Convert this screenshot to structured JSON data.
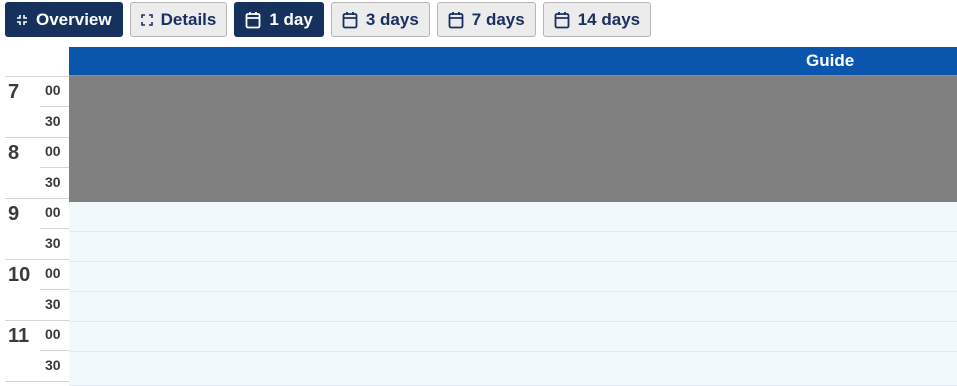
{
  "toolbar": {
    "buttons": [
      {
        "label": "Overview",
        "icon": "compress-icon",
        "active": true
      },
      {
        "label": "Details",
        "icon": "expand-icon",
        "active": false
      },
      {
        "label": "1 day",
        "icon": "calendar-icon",
        "active": true
      },
      {
        "label": "3 days",
        "icon": "calendar-icon",
        "active": false
      },
      {
        "label": "7 days",
        "icon": "calendar-icon",
        "active": false
      },
      {
        "label": "14 days",
        "icon": "calendar-icon",
        "active": false
      }
    ]
  },
  "schedule": {
    "resource": "Guide",
    "hours": [
      {
        "hour": "7",
        "minutes": [
          "00",
          "30"
        ]
      },
      {
        "hour": "8",
        "minutes": [
          "00",
          "30"
        ]
      },
      {
        "hour": "9",
        "minutes": [
          "00",
          "30"
        ]
      },
      {
        "hour": "10",
        "minutes": [
          "00",
          "30"
        ]
      },
      {
        "hour": "11",
        "minutes": [
          "00",
          "30"
        ]
      }
    ],
    "unavailable_until": "9:00"
  },
  "colors": {
    "primary_active": "#16325c",
    "header_blue": "#0a56ad",
    "unavailable": "#808080",
    "available": "#f2f9fd"
  }
}
